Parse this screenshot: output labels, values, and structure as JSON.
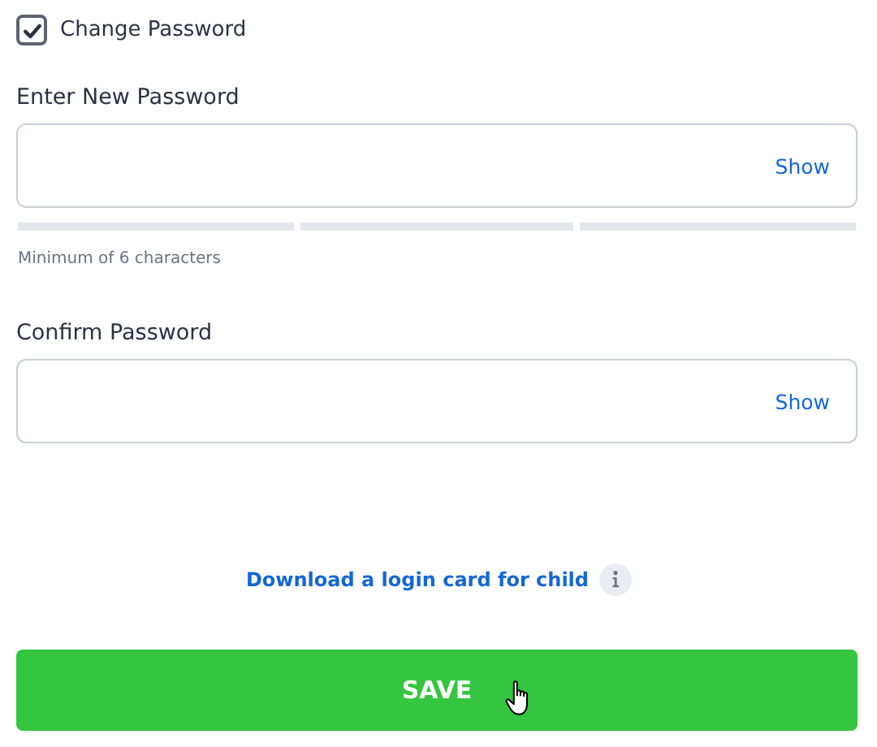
{
  "change_password": {
    "label": "Change Password",
    "checked": true
  },
  "new_password": {
    "label": "Enter New Password",
    "toggle": "Show"
  },
  "hint": "Minimum of 6 characters",
  "confirm_password": {
    "label": "Confirm Password",
    "toggle": "Show"
  },
  "login_card_link": "Download a login card for child",
  "save_button": "SAVE"
}
